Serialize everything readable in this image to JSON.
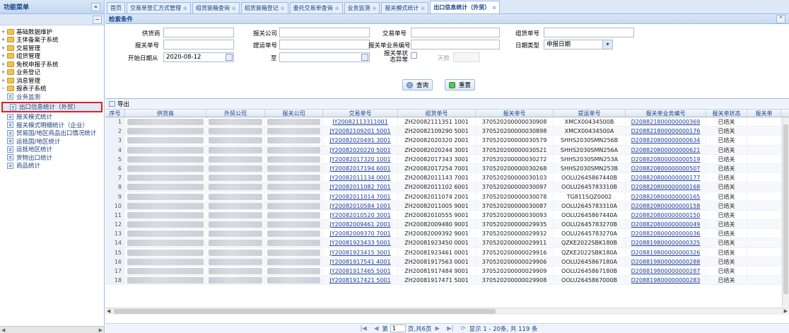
{
  "sidebar": {
    "title": "功能菜单",
    "collapse": "«",
    "nodes": [
      {
        "label": "基础数据维护",
        "toggle": "+"
      },
      {
        "label": "主体备案子系统",
        "toggle": "+"
      },
      {
        "label": "交易管理",
        "toggle": "+"
      },
      {
        "label": "组货管理",
        "toggle": "+"
      },
      {
        "label": "免税申报子系统",
        "toggle": "+"
      },
      {
        "label": "业务登记",
        "toggle": "+"
      },
      {
        "label": "消息管理",
        "toggle": "+"
      },
      {
        "label": "报表子系统",
        "toggle": "−"
      }
    ],
    "children": [
      {
        "label": "业务监测"
      },
      {
        "label": "出口信息统计（外贸）",
        "selected": true
      },
      {
        "label": "报关模式统计"
      },
      {
        "label": "报关模式明细统计（企业）"
      },
      {
        "label": "贸易国/地区商品出口情况统计"
      },
      {
        "label": "运抵国/地区统计"
      },
      {
        "label": "运抵地区统计"
      },
      {
        "label": "货物出口统计"
      },
      {
        "label": "商品统计"
      }
    ]
  },
  "tabs": [
    {
      "label": "首页",
      "closable": false
    },
    {
      "label": "交易单登汇方式管理"
    },
    {
      "label": "组货装箱查询"
    },
    {
      "label": "组货装箱登记"
    },
    {
      "label": "委托交易单查询"
    },
    {
      "label": "业务监测"
    },
    {
      "label": "报关模式统计"
    },
    {
      "label": "出口信息统计（外贸）",
      "active": true
    }
  ],
  "search": {
    "title": "检索条件",
    "labels": {
      "supplier": "供货商",
      "declare_company": "报关公司",
      "trade_no": "交易单号",
      "group_no": "组货单号",
      "declare_no": "报关单号",
      "bl_no": "提运单号",
      "declare_serial": "报关单业务编号",
      "date_type": "日期类型",
      "start_date": "开始日期从",
      "to": "至",
      "declare_status": "报关单状态异常",
      "days": "天数"
    },
    "values": {
      "date_type": "申报日期",
      "start_date": "2020-08-12"
    },
    "buttons": {
      "search": "查询",
      "reset": "重置"
    }
  },
  "toolbar": {
    "export": "导出"
  },
  "grid": {
    "columns": [
      "序号",
      "供货商",
      "外贸公司",
      "报关公司",
      "交易单号",
      "组货单号",
      "报关单号",
      "提运单号",
      "报关单业务编号",
      "报关单状态",
      "报关单"
    ],
    "rows": [
      {
        "seq": "1",
        "trade": "JY20082113311001",
        "group": "ZH20082111351 1001",
        "decl": "370520200000030908",
        "bl": "XMCX00434500B",
        "serial": "D208821800000000369",
        "status": "已结关"
      },
      {
        "seq": "2",
        "trade": "JY20082109201 5001",
        "group": "ZH20082109290 5001",
        "decl": "370520200000030898",
        "bl": "XMCX00434500A",
        "serial": "D208821800000000176",
        "status": "已结关"
      },
      {
        "seq": "3",
        "trade": "JY20082020491 3001",
        "group": "ZH20082020320 2001",
        "decl": "370520200000030579",
        "bl": "SHHS2030SMN256B",
        "serial": "D208820800000000634",
        "status": "已结关"
      },
      {
        "seq": "4",
        "trade": "JY20082020220 5001",
        "group": "ZH20082020244 3001",
        "decl": "370520200000030521",
        "bl": "SHHS2030SMN256A",
        "serial": "D208820800000000621",
        "status": "已结关"
      },
      {
        "seq": "5",
        "trade": "JY20082017320 1001",
        "group": "ZH20082017343 3001",
        "decl": "370520200000030272",
        "bl": "SHHS2030SMN253A",
        "serial": "D208820800000000519",
        "status": "已结关"
      },
      {
        "seq": "6",
        "trade": "JY20082017194 6001",
        "group": "ZH20082017254 7001",
        "decl": "370520200000030268",
        "bl": "SHHS2030SMN253B",
        "serial": "D208820800000000507",
        "status": "已结关"
      },
      {
        "seq": "7",
        "trade": "JY20082011134 0001",
        "group": "ZH20082011143 7001",
        "decl": "370520200000030103",
        "bl": "OOLU2645867440B",
        "serial": "D208820800000000177",
        "status": "已结关"
      },
      {
        "seq": "8",
        "trade": "JY20082011082 7001",
        "group": "ZH20082011102 6001",
        "decl": "370520200000030097",
        "bl": "OOLU2645783310B",
        "serial": "D208820800000000168",
        "status": "已结关"
      },
      {
        "seq": "9",
        "trade": "JY20082011014 7001",
        "group": "ZH20082011074 2001",
        "decl": "370520200000030078",
        "bl": "TG811SQZ0002",
        "serial": "D208820800000000165",
        "status": "已结关"
      },
      {
        "seq": "10",
        "trade": "JY20082010584 1001",
        "group": "ZH20082011005 9001",
        "decl": "370520200000030087",
        "bl": "OOLU2645783310A",
        "serial": "D208820800000000158",
        "status": "已结关"
      },
      {
        "seq": "11",
        "trade": "JY20082010520 3001",
        "group": "ZH20082010555 9001",
        "decl": "370520200000030093",
        "bl": "OOLU2645867440A",
        "serial": "D208820800000000150",
        "status": "已结关"
      },
      {
        "seq": "12",
        "trade": "JY20082009461 2001",
        "group": "ZH20082009480 9001",
        "decl": "370520200000029935",
        "bl": "OOLU2645783270B",
        "serial": "D208820800000000049",
        "status": "已结关"
      },
      {
        "seq": "13",
        "trade": "JY20082009370 7001",
        "group": "ZH20082009392 9001",
        "decl": "370520200000029932",
        "bl": "OOLU2645783270A",
        "serial": "D208820800000000036",
        "status": "已结关"
      },
      {
        "seq": "14",
        "trade": "JY20081923433 5001",
        "group": "ZH20081923450 0001",
        "decl": "370520200000029911",
        "bl": "QZKE2022SBK180B",
        "serial": "D208819800000000325",
        "status": "已结关"
      },
      {
        "seq": "15",
        "trade": "JY20081923415 3001",
        "group": "ZH20081923461 0001",
        "decl": "370520200000029916",
        "bl": "QZKE2022SBK180A",
        "serial": "D208819800000000326",
        "status": "已结关"
      },
      {
        "seq": "16",
        "trade": "JY20081917541 4001",
        "group": "ZH20081917563 0001",
        "decl": "370520200000029906",
        "bl": "OOLU2645867180A",
        "serial": "D208819800000000288",
        "status": "已结关"
      },
      {
        "seq": "17",
        "trade": "JY20081917465 5001",
        "group": "ZH20081917484 9001",
        "decl": "370520200000029909",
        "bl": "OOLU2645867180B",
        "serial": "D208819800000000287",
        "status": "已结关"
      },
      {
        "seq": "18",
        "trade": "JY20081917421 5001",
        "group": "ZH20081917471 5001",
        "decl": "370520200000029908",
        "bl": "OOLU2645867000B",
        "serial": "D208819800000000283",
        "status": "已结关"
      }
    ]
  },
  "pager": {
    "page_label": "第",
    "page": "1",
    "of_pages": "页,共6页",
    "summary": "显示 1 - 20条, 共 119 条"
  }
}
